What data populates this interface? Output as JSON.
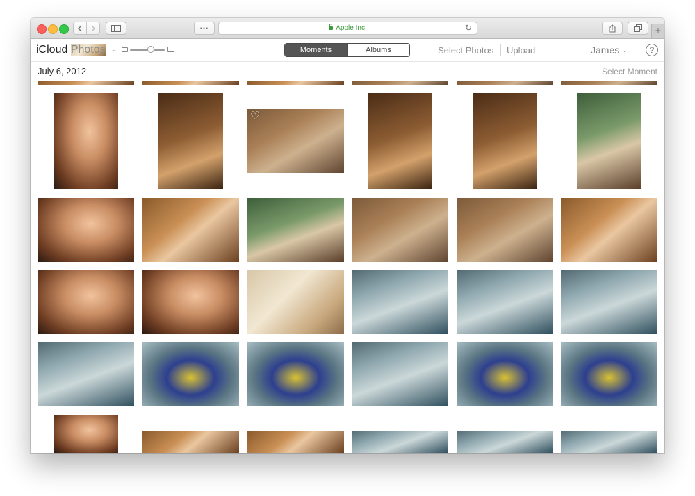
{
  "browser": {
    "url_text": "Apple Inc.",
    "tab_plus": "+",
    "tab_dots": "•••"
  },
  "header": {
    "brand_main": "iCloud",
    "brand_sub": "Photos",
    "segments": [
      "Moments",
      "Albums"
    ],
    "selected_segment": "Moments",
    "select_photos": "Select Photos",
    "upload": "Upload",
    "user": "James",
    "help": "?"
  },
  "moment": {
    "date": "July 6, 2012",
    "select_moment": "Select Moment"
  },
  "icons": {
    "back": "chevron-left-icon",
    "forward": "chevron-right-icon",
    "sidebar": "sidebar-icon",
    "reload": "reload-icon",
    "share": "share-icon",
    "tabs": "tabs-icon",
    "favorite": "heart-icon"
  },
  "grid": {
    "favorited_photo_index": 2
  }
}
